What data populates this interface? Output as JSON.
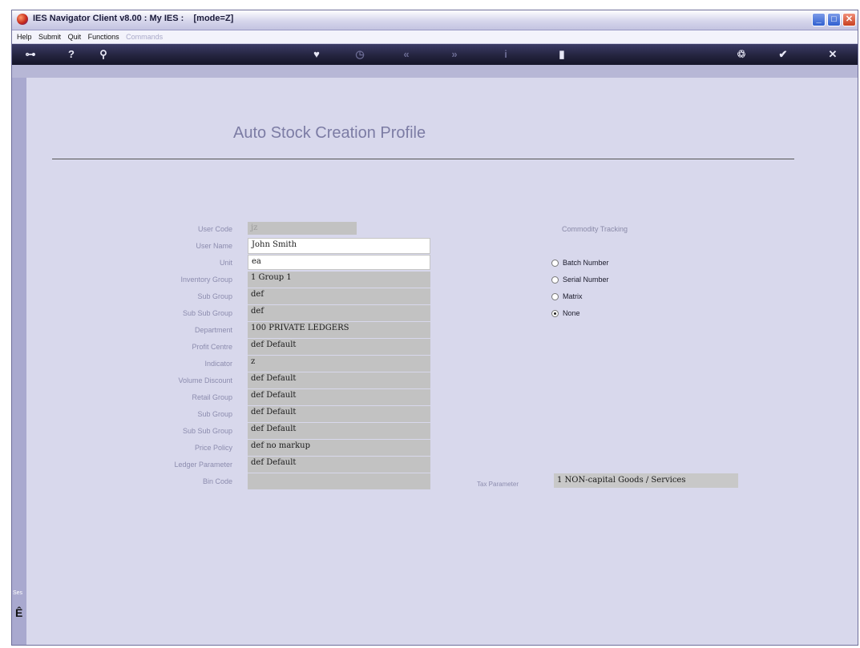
{
  "window": {
    "title": "IES Navigator Client v8.00 : My IES :",
    "mode": "[mode=Z]"
  },
  "menu": {
    "items": [
      "Help",
      "Submit",
      "Quit",
      "Functions"
    ],
    "commands": "Commands"
  },
  "toolbar": {
    "icons": [
      "key-icon",
      "help-icon",
      "search-icon",
      "heart-icon",
      "clock-icon",
      "back-icon",
      "forward-icon",
      "info-icon",
      "document-icon",
      "recycle-icon",
      "ok-icon",
      "close-icon"
    ]
  },
  "form": {
    "heading": "Auto Stock Creation Profile",
    "fields": {
      "user_code": {
        "label": "User Code",
        "value": "jz"
      },
      "user_name": {
        "label": "User Name",
        "value": "John Smith"
      },
      "unit": {
        "label": "Unit",
        "value": "ea"
      },
      "inventory_group": {
        "label": "Inventory Group",
        "value": "1 Group 1"
      },
      "sub_group": {
        "label": "Sub Group",
        "value": "def"
      },
      "sub_sub_group": {
        "label": "Sub Sub Group",
        "value": "def"
      },
      "department": {
        "label": "Department",
        "value": "100 PRIVATE LEDGERS"
      },
      "profit_centre": {
        "label": "Profit Centre",
        "value": "def Default"
      },
      "indicator": {
        "label": "Indicator",
        "value": "z"
      },
      "volume_discount": {
        "label": "Volume Discount",
        "value": "def Default"
      },
      "retail_group": {
        "label": "Retail Group",
        "value": "def Default"
      },
      "retail_sub_group": {
        "label": "Sub Group",
        "value": "def Default"
      },
      "retail_sub_sub_group": {
        "label": "Sub Sub Group",
        "value": "def Default"
      },
      "price_policy": {
        "label": "Price Policy",
        "value": "def no markup"
      },
      "ledger_parameter": {
        "label": "Ledger Parameter",
        "value": "def Default"
      },
      "bin_code": {
        "label": "Bin Code",
        "value": ""
      }
    },
    "commodity_tracking": {
      "label": "Commodity Tracking",
      "options": [
        "Batch Number",
        "Serial Number",
        "Matrix",
        "None"
      ],
      "selected": "None"
    },
    "tax_parameter": {
      "label": "Tax Parameter",
      "value": "1 NON-capital Goods / Services"
    }
  },
  "left_panel": {
    "tag": "Ses"
  }
}
